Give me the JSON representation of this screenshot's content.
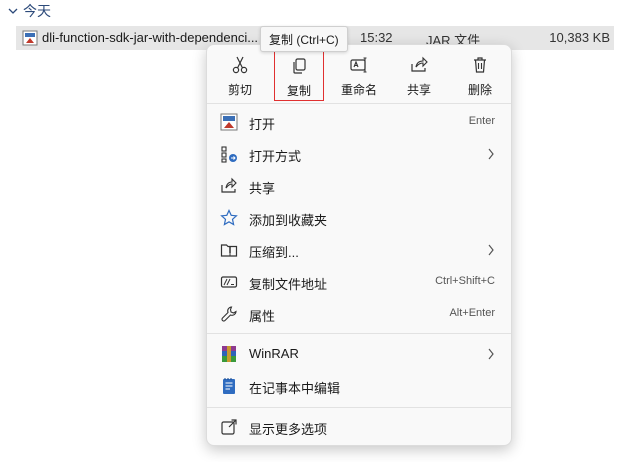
{
  "group": {
    "label": "今天"
  },
  "file": {
    "name": "dli-function-sdk-jar-with-dependenci...",
    "date": "15:32",
    "type": "JAR 文件",
    "size": "10,383 KB"
  },
  "tooltip": {
    "text": "复制 (Ctrl+C)"
  },
  "actions": [
    {
      "label": "剪切",
      "icon": "scissors-icon"
    },
    {
      "label": "复制",
      "icon": "copy-icon"
    },
    {
      "label": "重命名",
      "icon": "rename-icon"
    },
    {
      "label": "共享",
      "icon": "share-icon"
    },
    {
      "label": "删除",
      "icon": "trash-icon"
    }
  ],
  "items": [
    {
      "label": "打开",
      "shortcut": "Enter",
      "icon": "jar-file-icon"
    },
    {
      "label": "打开方式",
      "shortcut": "",
      "icon": "open-with-icon"
    },
    {
      "label": "共享",
      "shortcut": "",
      "icon": "share-icon"
    },
    {
      "label": "添加到收藏夹",
      "shortcut": "",
      "icon": "star-icon"
    },
    {
      "label": "压缩到...",
      "shortcut": "",
      "icon": "zip-folder-icon"
    },
    {
      "label": "复制文件地址",
      "shortcut": "Ctrl+Shift+C",
      "icon": "copy-path-icon"
    },
    {
      "label": "属性",
      "shortcut": "Alt+Enter",
      "icon": "wrench-icon"
    },
    {
      "label": "WinRAR",
      "shortcut": "",
      "icon": "winrar-icon"
    },
    {
      "label": "在记事本中编辑",
      "shortcut": "",
      "icon": "notepad-icon"
    },
    {
      "label": "显示更多选项",
      "shortcut": "",
      "icon": "more-options-icon"
    }
  ]
}
